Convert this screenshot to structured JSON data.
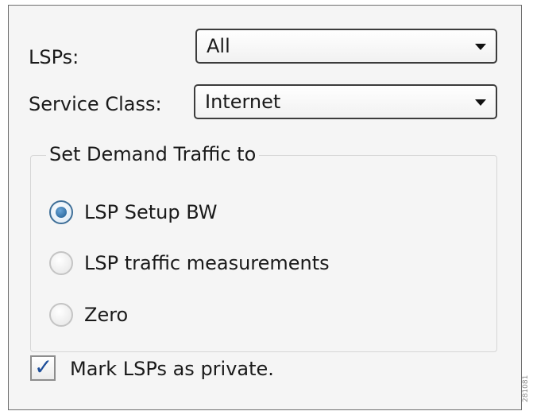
{
  "lsps": {
    "label": "LSPs:",
    "selected": "All"
  },
  "service_class": {
    "label": "Service Class:",
    "selected": "Internet"
  },
  "demand_traffic": {
    "title": "Set Demand Traffic to",
    "options": [
      {
        "label": "LSP Setup BW",
        "checked": true
      },
      {
        "label": "LSP traffic measurements",
        "checked": false
      },
      {
        "label": "Zero",
        "checked": false
      }
    ]
  },
  "mark_private": {
    "label": "Mark LSPs as private.",
    "checked": true
  },
  "colors": {
    "panel_bg": "#f5f5f5",
    "radio_checked": "#1f5b8f",
    "check_mark": "#1f4f9a"
  },
  "icons": {
    "dropdown": "chevron-down-icon",
    "check": "checkmark-icon"
  },
  "watermark": "281081"
}
